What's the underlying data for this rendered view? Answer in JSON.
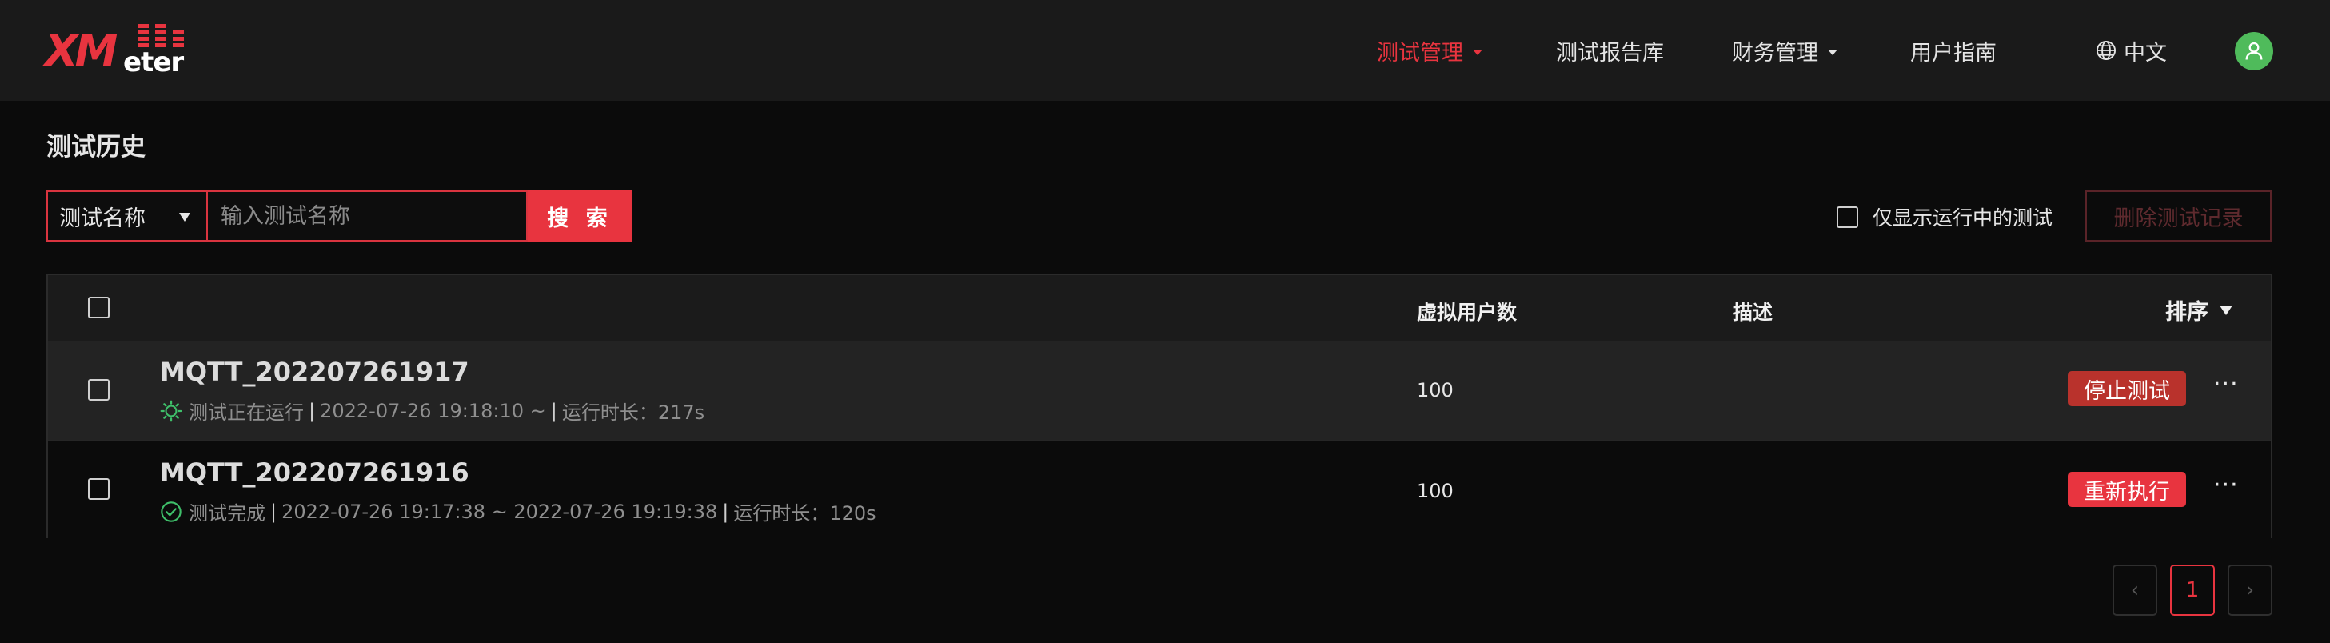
{
  "app": {
    "brand": "XMeter",
    "brand_mark": "XM",
    "brand_suffix": "eter",
    "accent_color": "#e8343f"
  },
  "nav": {
    "items": [
      {
        "label": "测试管理",
        "active": true,
        "dropdown": true
      },
      {
        "label": "测试报告库",
        "active": false,
        "dropdown": false
      },
      {
        "label": "财务管理",
        "active": false,
        "dropdown": true
      },
      {
        "label": "用户指南",
        "active": false,
        "dropdown": false
      }
    ],
    "language": "中文",
    "language_icon": "globe-icon",
    "avatar_icon": "user-icon"
  },
  "page": {
    "title": "测试历史"
  },
  "search": {
    "type_selected": "测试名称",
    "placeholder": "输入测试名称",
    "value": "",
    "button_label": "搜 索"
  },
  "filters": {
    "running_only_label": "仅显示运行中的测试",
    "running_only_checked": false
  },
  "actions": {
    "delete_label": "删除测试记录"
  },
  "table": {
    "headers": {
      "virtual_users": "虚拟用户数",
      "description": "描述",
      "sort": "排序"
    },
    "rows": [
      {
        "name": "MQTT_202207261917",
        "status_icon": "running-gear-icon",
        "status": "测试正在运行",
        "sep1": "|",
        "time_range": "2022-07-26 19:18:10 ~",
        "sep2": "|",
        "duration": "运行时长：217s",
        "virtual_users": "100",
        "description": "",
        "action_label": "停止测试",
        "more": "···"
      },
      {
        "name": "MQTT_202207261916",
        "status_icon": "check-circle-icon",
        "status": "测试完成",
        "sep1": "|",
        "time_range": "2022-07-26 19:17:38 ~ 2022-07-26 19:19:38",
        "sep2": "|",
        "duration": "运行时长：120s",
        "virtual_users": "100",
        "description": "",
        "action_label": "重新执行",
        "more": "···"
      }
    ]
  },
  "pagination": {
    "prev": "‹",
    "current": "1",
    "next": "›"
  }
}
